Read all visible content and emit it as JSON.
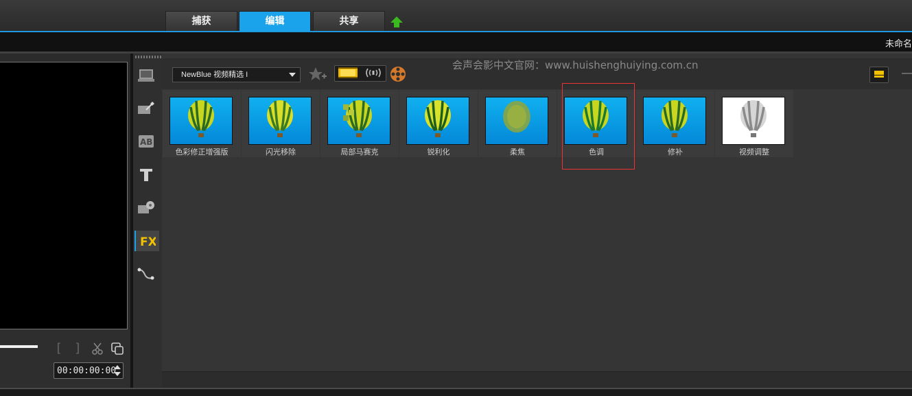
{
  "tabs": [
    {
      "label": "捕获"
    },
    {
      "label": "编辑"
    },
    {
      "label": "共享"
    }
  ],
  "active_tab": "编辑",
  "project_title": "未命名",
  "timecode": "00:00:00:00",
  "library": {
    "category_dropdown": "NewBlue 视频精选 I",
    "watermark": "会声会影中文官网：www.huishenghuiying.com.cn",
    "effects": [
      {
        "label": "色彩修正增强版"
      },
      {
        "label": "闪光移除"
      },
      {
        "label": "局部马赛克"
      },
      {
        "label": "锐利化"
      },
      {
        "label": "柔焦"
      },
      {
        "label": "色调"
      },
      {
        "label": "修补"
      },
      {
        "label": "视频调整"
      }
    ],
    "selected_effect": "色调"
  },
  "colors": {
    "accent": "#1aa3ea",
    "highlight": "#e33333",
    "upload_arrow": "#3bb820"
  }
}
